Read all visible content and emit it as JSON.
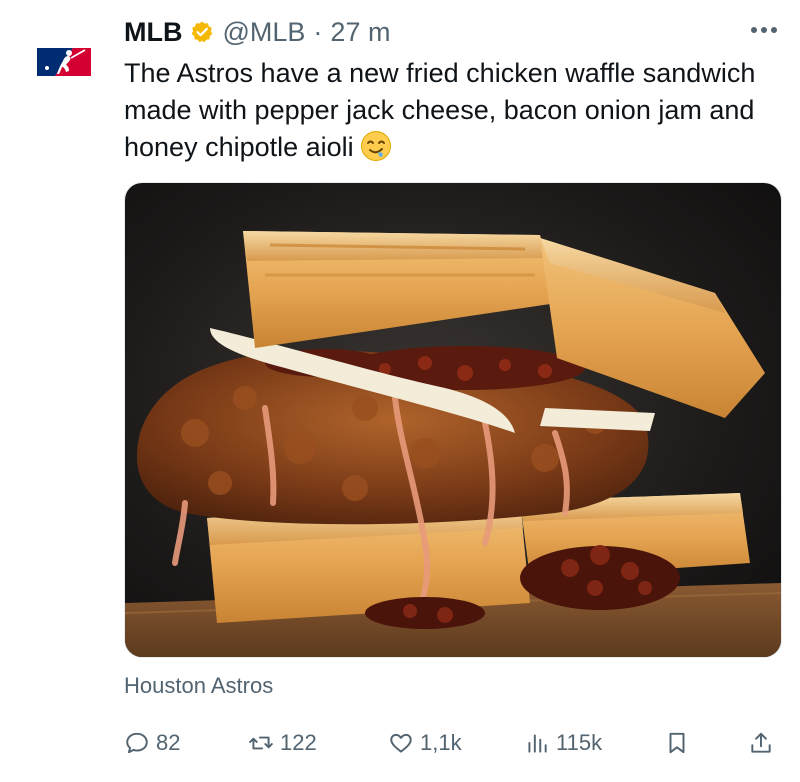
{
  "author": {
    "name": "MLB",
    "handle": "@MLB",
    "separator": "·",
    "time": "27 m",
    "verified": true
  },
  "tweet": {
    "text": "The Astros have a new fried chicken waffle sandwich made with pepper jack cheese, bacon onion jam and honey chipotle aioli",
    "emoji": "drooling-face-emoji"
  },
  "media": {
    "subject": "fried chicken waffle sandwich photo"
  },
  "caption": "Houston Astros",
  "actions": {
    "replies": "82",
    "retweets": "122",
    "likes": "1,1k",
    "views": "115k"
  },
  "colors": {
    "text": "#0f1419",
    "secondary": "#536471",
    "verified_badge": "#f5b800",
    "mlb_blue": "#002d72",
    "mlb_red": "#d50032"
  }
}
